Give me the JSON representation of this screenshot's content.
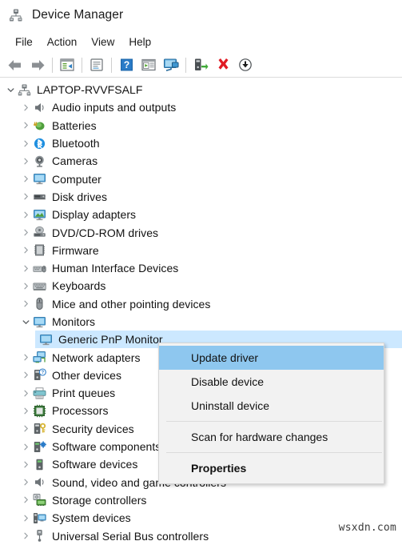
{
  "window": {
    "title": "Device Manager",
    "app_icon": "device-manager-icon"
  },
  "menubar": {
    "items": [
      {
        "label": "File"
      },
      {
        "label": "Action"
      },
      {
        "label": "View"
      },
      {
        "label": "Help"
      }
    ]
  },
  "toolbar": {
    "buttons": [
      {
        "icon": "back-arrow-icon",
        "label": "Back"
      },
      {
        "icon": "forward-arrow-icon",
        "label": "Forward"
      },
      {
        "sep": true
      },
      {
        "icon": "properties-icon",
        "label": "Properties"
      },
      {
        "sep": true
      },
      {
        "icon": "show-hidden-devices-icon",
        "label": "Show hidden devices"
      },
      {
        "sep": true
      },
      {
        "icon": "help-icon",
        "label": "Help"
      },
      {
        "icon": "update-driver-icon",
        "label": "Update driver"
      },
      {
        "icon": "scan-hardware-icon",
        "label": "Scan for hardware changes"
      },
      {
        "sep": true
      },
      {
        "icon": "enable-device-icon",
        "label": "Enable device"
      },
      {
        "icon": "uninstall-device-icon",
        "label": "Uninstall device"
      },
      {
        "icon": "install-driver-icon",
        "label": "Install legacy driver"
      }
    ]
  },
  "tree": {
    "root": {
      "label": "LAPTOP-RVVFSALF",
      "icon": "computer-root-icon",
      "expanded": true
    },
    "nodes": [
      {
        "label": "Audio inputs and outputs",
        "icon": "speaker-icon",
        "depth": 1,
        "expanded": false
      },
      {
        "label": "Batteries",
        "icon": "battery-icon",
        "depth": 1,
        "expanded": false
      },
      {
        "label": "Bluetooth",
        "icon": "bluetooth-icon",
        "depth": 1,
        "expanded": false
      },
      {
        "label": "Cameras",
        "icon": "camera-icon",
        "depth": 1,
        "expanded": false
      },
      {
        "label": "Computer",
        "icon": "monitor-icon",
        "depth": 1,
        "expanded": false
      },
      {
        "label": "Disk drives",
        "icon": "disk-drive-icon",
        "depth": 1,
        "expanded": false
      },
      {
        "label": "Display adapters",
        "icon": "display-adapter-icon",
        "depth": 1,
        "expanded": false
      },
      {
        "label": "DVD/CD-ROM drives",
        "icon": "dvd-drive-icon",
        "depth": 1,
        "expanded": false
      },
      {
        "label": "Firmware",
        "icon": "firmware-icon",
        "depth": 1,
        "expanded": false
      },
      {
        "label": "Human Interface Devices",
        "icon": "hid-icon",
        "depth": 1,
        "expanded": false
      },
      {
        "label": "Keyboards",
        "icon": "keyboard-icon",
        "depth": 1,
        "expanded": false
      },
      {
        "label": "Mice and other pointing devices",
        "icon": "mouse-icon",
        "depth": 1,
        "expanded": false
      },
      {
        "label": "Monitors",
        "icon": "monitor-icon",
        "depth": 1,
        "expanded": true
      },
      {
        "label": "Generic PnP Monitor",
        "icon": "monitor-icon",
        "depth": 2,
        "selected": true
      },
      {
        "label": "Network adapters",
        "icon": "network-adapter-icon",
        "depth": 1,
        "expanded": false
      },
      {
        "label": "Other devices",
        "icon": "other-device-icon",
        "depth": 1,
        "expanded": false
      },
      {
        "label": "Print queues",
        "icon": "printer-icon",
        "depth": 1,
        "expanded": false
      },
      {
        "label": "Processors",
        "icon": "processor-icon",
        "depth": 1,
        "expanded": false
      },
      {
        "label": "Security devices",
        "icon": "security-device-icon",
        "depth": 1,
        "expanded": false
      },
      {
        "label": "Software components",
        "icon": "software-component-icon",
        "depth": 1,
        "expanded": false
      },
      {
        "label": "Software devices",
        "icon": "software-device-icon",
        "depth": 1,
        "expanded": false
      },
      {
        "label": "Sound, video and game controllers",
        "icon": "sound-controller-icon",
        "depth": 1,
        "expanded": false
      },
      {
        "label": "Storage controllers",
        "icon": "storage-controller-icon",
        "depth": 1,
        "expanded": false
      },
      {
        "label": "System devices",
        "icon": "system-device-icon",
        "depth": 1,
        "expanded": false
      },
      {
        "label": "Universal Serial Bus controllers",
        "icon": "usb-controller-icon",
        "depth": 1,
        "expanded": false
      }
    ]
  },
  "context_menu": {
    "items": [
      {
        "label": "Update driver",
        "highlight": true
      },
      {
        "label": "Disable device"
      },
      {
        "label": "Uninstall device"
      },
      {
        "sep": true
      },
      {
        "label": "Scan for hardware changes"
      },
      {
        "sep": true
      },
      {
        "label": "Properties",
        "bold": true
      }
    ]
  },
  "watermark": {
    "text": "wsxdn.com"
  },
  "colors": {
    "selection": "#cce8ff",
    "menu_highlight": "#8ec7ef",
    "menu_bg": "#f2f2f2",
    "accent_blue": "#0078d7"
  }
}
